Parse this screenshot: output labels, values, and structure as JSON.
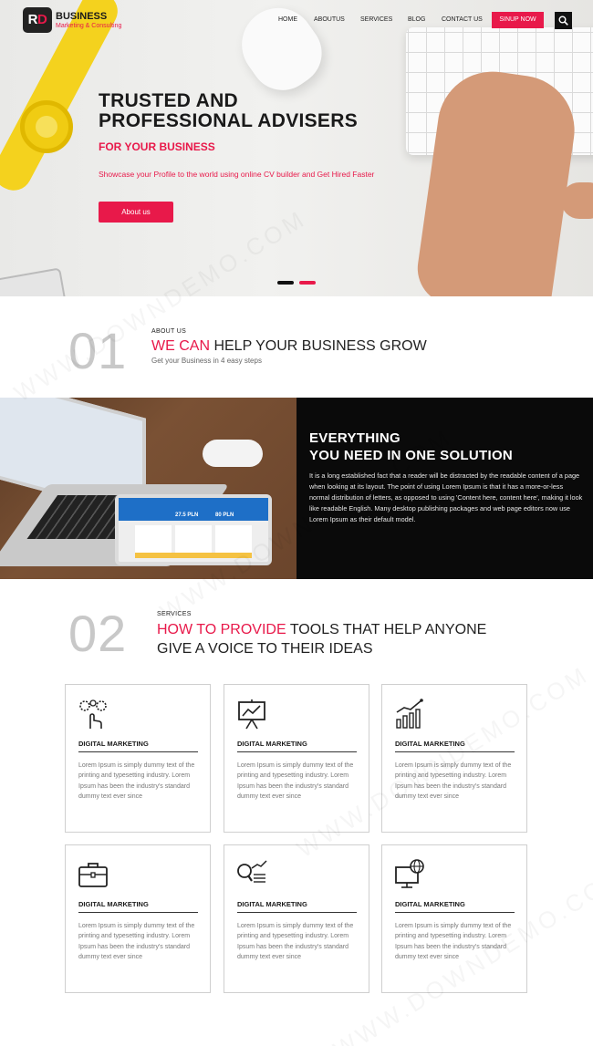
{
  "brand": {
    "logo_text_white": "R",
    "logo_text_accent": "D",
    "title": "BUSINESS",
    "subtitle": "Marketing & Consulting",
    "accent_color": "#e8194a"
  },
  "nav": {
    "items": [
      "HOME",
      "ABOUTUS",
      "SERVICES",
      "BLOG",
      "CONTACT US"
    ],
    "signup_label": "SINUP NOW",
    "search_icon": "search-icon"
  },
  "hero": {
    "title_line1": "TRUSTED AND",
    "title_line2": "PROFESSIONAL ADVISERS",
    "subtitle": "FOR YOUR BUSINESS",
    "description": "Showcase your Profile to the world using online CV builder and Get Hired Faster",
    "button_label": "About us",
    "slides_total": 2,
    "active_slide": 2
  },
  "about": {
    "number": "01",
    "label": "ABOUT US",
    "title_accent": "WE CAN",
    "title_rest": " HELP YOUR BUSINESS GROW",
    "subtitle": "Get your Business in 4 easy steps"
  },
  "solution": {
    "heading_line1": "EVERYTHING",
    "heading_line2": "YOU NEED IN ONE SOLUTION",
    "text": "It is a long established fact that a reader will be distracted by the readable content of a page when looking at its layout. The point of using Lorem Ipsum is that it has a more-or-less normal distribution of letters, as opposed to using 'Content here, content here', making it look like readable English. Many desktop publishing packages and web page editors now use Lorem Ipsum as their default model.",
    "tablet_price1": "27.5 PLN",
    "tablet_price2": "80 PLN"
  },
  "services": {
    "number": "02",
    "label": "SERVICES",
    "title_accent": "HOW TO PROVIDE",
    "title_rest": " TOOLS THAT HELP ANYONE",
    "title_line2": "GIVE A VOICE TO THEIR IDEAS",
    "cards": [
      {
        "icon": "gears-hand-icon",
        "title": "DIGITAL MARKETING",
        "text": "Lorem Ipsum is simply dummy text of the printing and typesetting industry. Lorem Ipsum has been the industry's standard dummy text ever since"
      },
      {
        "icon": "presentation-board-icon",
        "title": "DIGITAL MARKETING",
        "text": "Lorem Ipsum is simply dummy text of the printing and typesetting industry. Lorem Ipsum has been the industry's standard dummy text ever since"
      },
      {
        "icon": "growth-chart-icon",
        "title": "DIGITAL MARKETING",
        "text": "Lorem Ipsum is simply dummy text of the printing and typesetting industry. Lorem Ipsum has been the industry's standard dummy text ever since"
      },
      {
        "icon": "briefcase-icon",
        "title": "DIGITAL MARKETING",
        "text": "Lorem Ipsum is simply dummy text of the printing and typesetting industry. Lorem Ipsum has been the industry's standard dummy text ever since"
      },
      {
        "icon": "magnifier-chart-icon",
        "title": "DIGITAL MARKETING",
        "text": "Lorem Ipsum is simply dummy text of the printing and typesetting industry. Lorem Ipsum has been the industry's standard dummy text ever since"
      },
      {
        "icon": "global-monitor-icon",
        "title": "DIGITAL MARKETING",
        "text": "Lorem Ipsum is simply dummy text of the printing and typesetting industry. Lorem Ipsum has been the industry's standard dummy text ever since"
      }
    ]
  },
  "watermark": "WWW.DOWNDEMO.COM"
}
